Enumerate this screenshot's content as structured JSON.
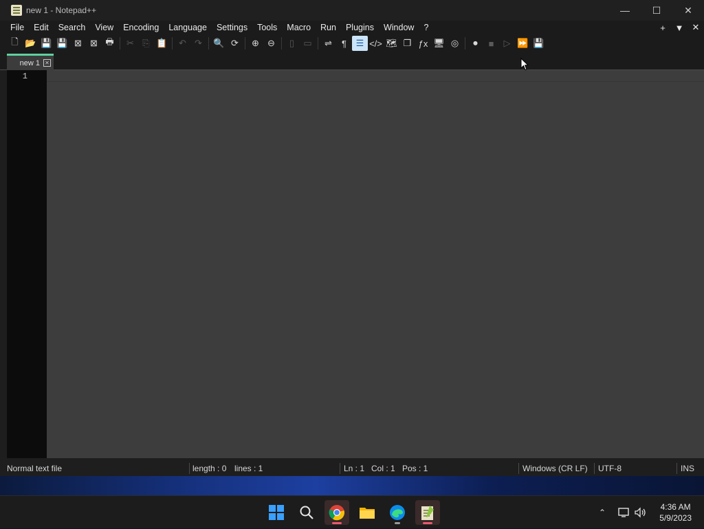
{
  "window": {
    "title": "new 1 - Notepad++",
    "controls": {
      "minimize": "—",
      "maximize": "☐",
      "close": "✕"
    }
  },
  "menu": {
    "items": [
      "File",
      "Edit",
      "Search",
      "View",
      "Encoding",
      "Language",
      "Settings",
      "Tools",
      "Macro",
      "Run",
      "Plugins",
      "Window",
      "?"
    ],
    "right": {
      "add": "+",
      "dropdown": "▼",
      "close": "✕"
    }
  },
  "toolbar": {
    "icons": [
      {
        "name": "new-file-icon",
        "glyph": "🗋",
        "dim": false
      },
      {
        "name": "open-file-icon",
        "glyph": "📂",
        "dim": false
      },
      {
        "name": "save-icon",
        "glyph": "💾",
        "dim": true
      },
      {
        "name": "save-all-icon",
        "glyph": "💾",
        "dim": true
      },
      {
        "name": "close-file-icon",
        "glyph": "⊠",
        "dim": false
      },
      {
        "name": "close-all-icon",
        "glyph": "⊠",
        "dim": false
      },
      {
        "name": "print-icon",
        "glyph": "🖶",
        "dim": false
      },
      {
        "sep": true
      },
      {
        "name": "cut-icon",
        "glyph": "✂",
        "dim": true
      },
      {
        "name": "copy-icon",
        "glyph": "⎘",
        "dim": true
      },
      {
        "name": "paste-icon",
        "glyph": "📋",
        "dim": true
      },
      {
        "sep": true
      },
      {
        "name": "undo-icon",
        "glyph": "↶",
        "dim": true
      },
      {
        "name": "redo-icon",
        "glyph": "↷",
        "dim": true
      },
      {
        "sep": true
      },
      {
        "name": "find-icon",
        "glyph": "🔍",
        "dim": false
      },
      {
        "name": "replace-icon",
        "glyph": "⟳",
        "dim": false
      },
      {
        "sep": true
      },
      {
        "name": "zoom-in-icon",
        "glyph": "⊕",
        "dim": false
      },
      {
        "name": "zoom-out-icon",
        "glyph": "⊖",
        "dim": false
      },
      {
        "sep": true
      },
      {
        "name": "sync-vertical-icon",
        "glyph": "▯",
        "dim": true
      },
      {
        "name": "sync-horizontal-icon",
        "glyph": "▭",
        "dim": true
      },
      {
        "sep": true
      },
      {
        "name": "word-wrap-icon",
        "glyph": "⇌",
        "dim": false
      },
      {
        "name": "show-all-chars-icon",
        "glyph": "¶",
        "dim": false
      },
      {
        "name": "indent-guide-icon",
        "glyph": "☰",
        "dim": false,
        "active": true
      },
      {
        "name": "xml-tag-icon",
        "glyph": "</>",
        "dim": false
      },
      {
        "name": "document-map-icon",
        "glyph": "🗺",
        "dim": false
      },
      {
        "name": "document-list-icon",
        "glyph": "❐",
        "dim": false
      },
      {
        "name": "function-list-icon",
        "glyph": "ƒx",
        "dim": false
      },
      {
        "name": "folder-workspace-icon",
        "glyph": "🖥",
        "dim": false
      },
      {
        "name": "monitoring-icon",
        "glyph": "◎",
        "dim": false
      },
      {
        "sep": true
      },
      {
        "name": "record-macro-icon",
        "glyph": "⏺",
        "dim": false
      },
      {
        "name": "stop-macro-icon",
        "glyph": "■",
        "dim": true
      },
      {
        "name": "play-macro-icon",
        "glyph": "▷",
        "dim": true
      },
      {
        "name": "run-macro-multiple-icon",
        "glyph": "⏩",
        "dim": false
      },
      {
        "name": "save-macro-icon",
        "glyph": "💾",
        "dim": true
      }
    ]
  },
  "tab": {
    "label": "new 1",
    "close": "✕"
  },
  "editor": {
    "line_number": "1"
  },
  "status": {
    "file_type": "Normal text file",
    "length": "length : 0",
    "lines": "lines : 1",
    "ln": "Ln : 1",
    "col": "Col : 1",
    "pos": "Pos : 1",
    "eol": "Windows (CR LF)",
    "encoding": "UTF-8",
    "mode": "INS"
  },
  "taskbar": {
    "clock_time": "4:36 AM",
    "clock_date": "5/9/2023"
  },
  "colors": {
    "accent_tab": "#5fd0a0",
    "active_toolbar": "#cce4f7",
    "editor_bg": "#3d3d3d"
  }
}
